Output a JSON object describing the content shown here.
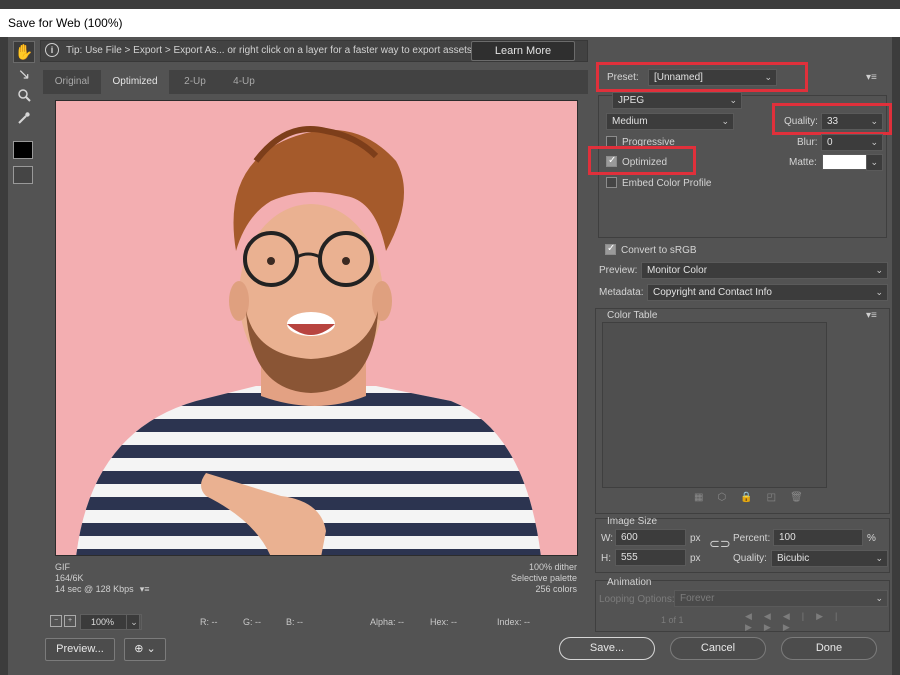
{
  "window": {
    "title": "Save for Web (100%)"
  },
  "tip": {
    "icon": "info-icon",
    "text": "Tip: Use File > Export > Export As...  or right click on a layer for a faster way to export assets",
    "learn_more": "Learn More"
  },
  "tabs": [
    "Original",
    "Optimized",
    "2-Up",
    "4-Up"
  ],
  "active_tab": "Optimized",
  "image_info_left": [
    "GIF",
    "164/6K",
    "14 sec @ 128 Kbps"
  ],
  "image_info_right": [
    "100% dither",
    "Selective palette",
    "256 colors"
  ],
  "status": {
    "zoom": "100%",
    "r": "R: --",
    "g": "G: --",
    "b": "B: --",
    "alpha": "Alpha: --",
    "hex": "Hex: --",
    "index": "Index: --"
  },
  "buttons": {
    "preview": "Preview...",
    "save": "Save...",
    "cancel": "Cancel",
    "done": "Done"
  },
  "settings": {
    "preset_label": "Preset:",
    "preset_value": "[Unnamed]",
    "format": "JPEG",
    "compression": "Medium",
    "quality_label": "Quality:",
    "quality_value": "33",
    "blur_label": "Blur:",
    "blur_value": "0",
    "matte_label": "Matte:",
    "progressive": {
      "label": "Progressive",
      "checked": false
    },
    "optimized": {
      "label": "Optimized",
      "checked": true
    },
    "embed_profile": {
      "label": "Embed Color Profile",
      "checked": false
    },
    "convert_srgb": {
      "label": "Convert to sRGB",
      "checked": true
    },
    "preview_label": "Preview:",
    "preview_value": "Monitor Color",
    "metadata_label": "Metadata:",
    "metadata_value": "Copyright and Contact Info"
  },
  "color_table": {
    "title": "Color Table"
  },
  "image_size": {
    "title": "Image Size",
    "w_label": "W:",
    "w_value": "600",
    "h_label": "H:",
    "h_value": "555",
    "unit": "px",
    "percent_label": "Percent:",
    "percent_value": "100",
    "percent_unit": "%",
    "quality_label": "Quality:",
    "quality_value": "Bicubic"
  },
  "animation": {
    "title": "Animation",
    "looping_label": "Looping Options:",
    "looping_value": "Forever",
    "frame": "1 of 1"
  },
  "colors": {
    "highlight": "#e0303b",
    "background": "#f3aeb1"
  }
}
